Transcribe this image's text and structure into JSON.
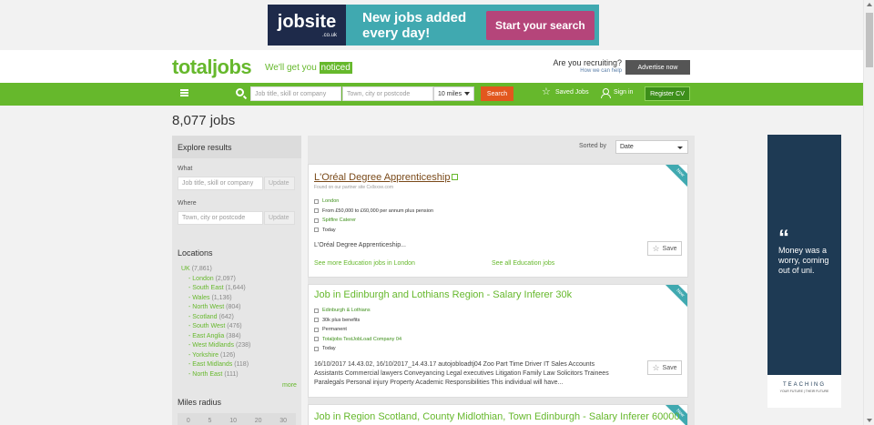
{
  "banner": {
    "logo": "jobsite",
    "logo_sub": ".co.uk",
    "tagline": "New jobs added every day!",
    "cta": "Start your search",
    "colors": {
      "background": "#40a9b0",
      "logo_bg": "#1e2a4a",
      "cta_bg": "#b5457a"
    }
  },
  "header": {
    "brand": "totaljobs",
    "tagline_prefix": "We'll get you",
    "tagline_highlight": "noticed",
    "recruiting": "Are you recruiting?",
    "recruiting_sub": "How we can help",
    "advertise": "Advertise now",
    "brand_color": "#66b82c"
  },
  "nav": {
    "menu_icon": "hamburger-icon",
    "search_icon": "search-icon",
    "keyword_placeholder": "Job title, skill or company",
    "location_placeholder": "Town, city or postcode",
    "radius": "10 miles",
    "search_button": "Search",
    "saved_jobs": "Saved Jobs",
    "sign_in": "Sign in",
    "register": "Register CV"
  },
  "results": {
    "count": "8,077",
    "count_label": "jobs",
    "sorted_by_label": "Sorted by",
    "sort_value": "Date"
  },
  "sidebar": {
    "heading": "Explore results",
    "what_label": "What",
    "what_placeholder": "Job title, skill or company",
    "where_label": "Where",
    "where_placeholder": "Town, city or postcode",
    "update": "Update",
    "locations_title": "Locations",
    "locations": [
      {
        "name": "UK",
        "count": "(7,861)",
        "sub": false
      },
      {
        "name": "London",
        "count": "(2,097)",
        "sub": true
      },
      {
        "name": "South East",
        "count": "(1,644)",
        "sub": true
      },
      {
        "name": "Wales",
        "count": "(1,136)",
        "sub": true
      },
      {
        "name": "North West",
        "count": "(804)",
        "sub": true
      },
      {
        "name": "Scotland",
        "count": "(642)",
        "sub": true
      },
      {
        "name": "South West",
        "count": "(476)",
        "sub": true
      },
      {
        "name": "East Anglia",
        "count": "(384)",
        "sub": true
      },
      {
        "name": "West Midlands",
        "count": "(238)",
        "sub": true
      },
      {
        "name": "Yorkshire",
        "count": "(126)",
        "sub": true
      },
      {
        "name": "East Midlands",
        "count": "(118)",
        "sub": true
      },
      {
        "name": "North East",
        "count": "(111)",
        "sub": true
      }
    ],
    "more": "more",
    "miles_title": "Miles radius",
    "miles": [
      "0",
      "5",
      "10",
      "20",
      "30"
    ]
  },
  "jobs": [
    {
      "title": "L'Oréal Degree Apprenticeship",
      "external": true,
      "found_on": "Found on our partner site Cxllxxxe.com",
      "location": "London",
      "salary": "From £50,000 to £60,000 per annum plus pension",
      "company": "Spitfire Caterer",
      "posted": "Today",
      "description": "L'Oréal Degree Apprenticeship...",
      "save": "Save",
      "badge": "New",
      "link_more": "See more Education jobs in London",
      "link_all": "See all Education jobs"
    },
    {
      "title": "Job in Edinburgh and Lothians Region - Salary Inferer 30k",
      "external": false,
      "location": "Edinburgh & Lothians",
      "salary": "30k plus benefits",
      "type": "Permanent",
      "company": "Totaljobs TestJobLoad Company 04",
      "posted": "Today",
      "description": "16/10/2017 14.43.02, 16/10/2017_14.43.17 autojobloadtj04 Zoo Part Time Driver IT Sales Accounts Assistants Commercial lawyers Conveyancing Legal executives Litigation Family Law Solicitors Trainees Paralegals Personal injury Property Academic Responsibilities This individual will have...",
      "save": "Save",
      "badge": "New"
    },
    {
      "title": "Job in Region Scotland, County Midlothian, Town Edinburgh - Salary Inferer 60000",
      "badge": "New"
    }
  ],
  "side_ad": {
    "text": "Money was a worry, coming out of uni.",
    "footer": "TEACHING",
    "footer_sub": "YOUR FUTURE | THEIR FUTURE",
    "bg_color": "#1e3a54"
  }
}
